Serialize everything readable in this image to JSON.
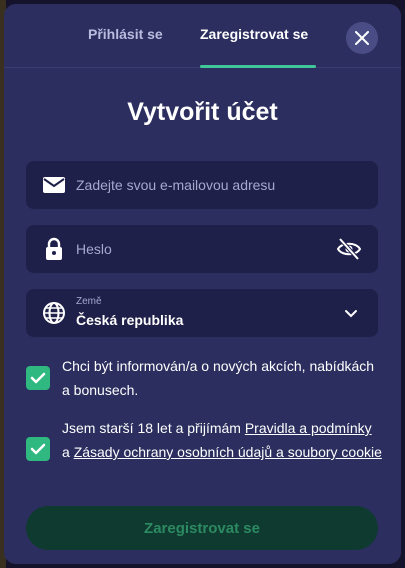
{
  "tabs": {
    "login_label": "Přihlásit se",
    "register_label": "Zaregistrovat se"
  },
  "title": "Vytvořit účet",
  "email": {
    "placeholder": "Zadejte svou e-mailovou adresu",
    "value": ""
  },
  "password": {
    "placeholder": "Heslo",
    "value": ""
  },
  "country": {
    "label": "Země",
    "value": "Česká republika"
  },
  "newsletter": {
    "checked": true,
    "text": "Chci být informován/a o nových akcích, nabídkách a bonusech."
  },
  "terms": {
    "checked": true,
    "text_before": "Jsem starší 18 let a přijímám ",
    "terms_link": "Pravidla a podmínky",
    "text_middle": " a ",
    "privacy_link": "Zásady ochrany osobních údajů a soubory cookie"
  },
  "submit_label": "Zaregistrovat se",
  "colors": {
    "modal_bg": "#2b2e5e",
    "field_bg": "#1f2049",
    "accent": "#3fc79a",
    "checkbox": "#2fb87f",
    "submit_bg": "#0f3a2f",
    "submit_text": "#2c8a63"
  },
  "icons": {
    "close": "close-icon",
    "email": "mail-icon",
    "password": "lock-icon",
    "visibility": "eye-off-icon",
    "country": "globe-icon",
    "dropdown": "chevron-down-icon",
    "checkbox": "checkmark-icon"
  }
}
